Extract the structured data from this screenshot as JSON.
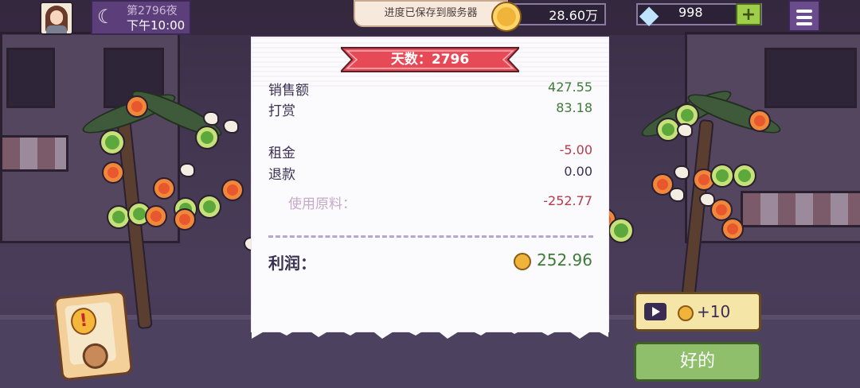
{
  "hud": {
    "day_label": "第2796夜",
    "time_label": "下午10:00",
    "save_toast": "进度已保存到服务器",
    "coins": "28.60万",
    "gems": "998",
    "add_gems_label": "+"
  },
  "receipt": {
    "title": "天数：2796",
    "rows": [
      {
        "label": "销售额",
        "value": "427.55"
      },
      {
        "label": "打赏",
        "value": "83.18"
      },
      {
        "label": "租金",
        "value": "-5.00"
      },
      {
        "label": "退款",
        "value": "0.00"
      },
      {
        "label": "使用原料：",
        "value": "-252.77"
      }
    ],
    "profit_label": "利润：",
    "profit_value": "252.96"
  },
  "buttons": {
    "ad_reward": "+10",
    "ok": "好的"
  },
  "icons": [
    "moon-icon",
    "coin-icon",
    "gem-icon",
    "menu-icon",
    "play-icon",
    "alert-icon"
  ],
  "colors": {
    "positive": "#3f7b3a",
    "negative": "#b63a4a",
    "ribbon": "#e64a57",
    "ok_button": "#8fbf6a"
  }
}
